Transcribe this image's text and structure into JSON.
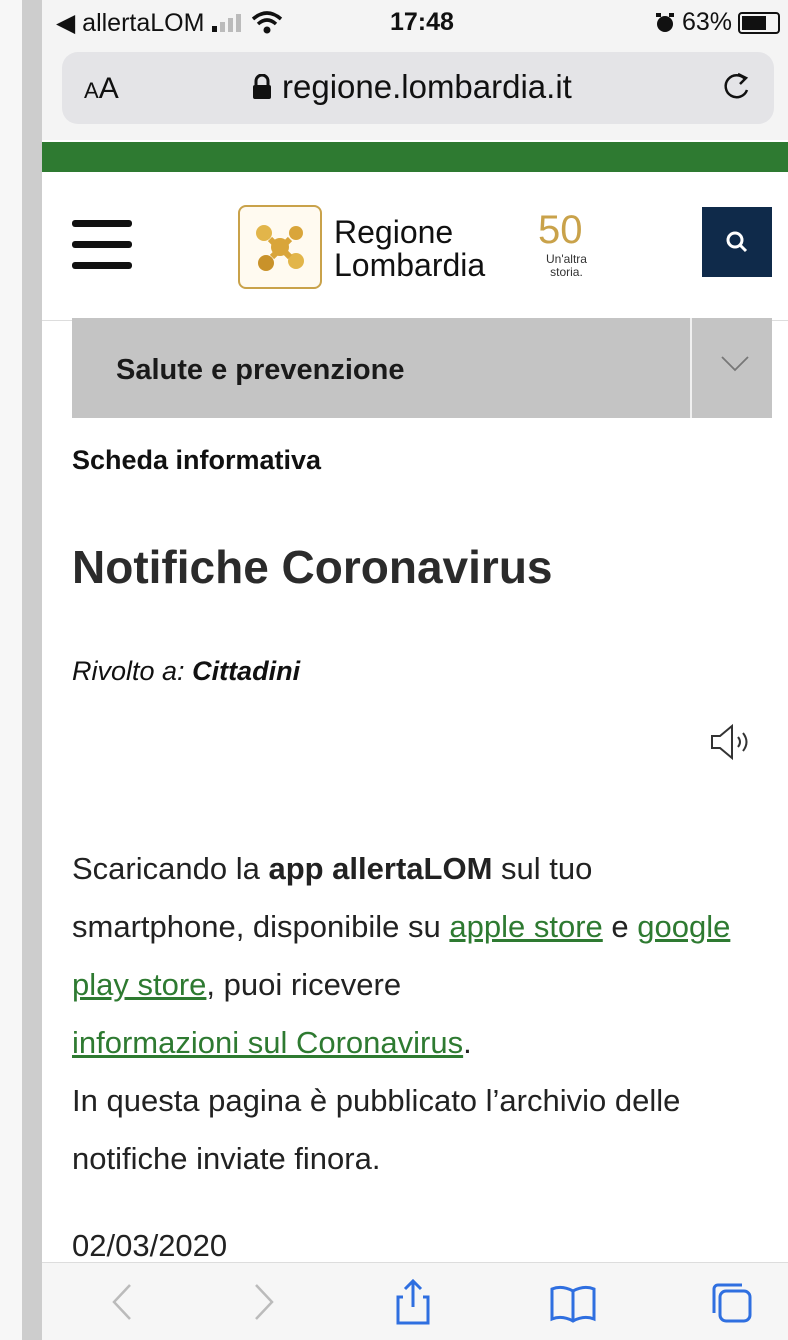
{
  "status_bar": {
    "carrier": "◀ allertaLOM",
    "time": "17:48",
    "battery": "63%",
    "battery_level": 0.63
  },
  "browser": {
    "aa_label_small": "A",
    "aa_label_large": "A",
    "url": "regione.lombardia.it"
  },
  "header": {
    "logo_line1": "Regione",
    "logo_line2": "Lombardia",
    "anniversary_number": "50",
    "anniversary_line1": "Un'altra",
    "anniversary_line2": "storia."
  },
  "section": {
    "title": "Salute e prevenzione"
  },
  "page": {
    "category": "Scheda informativa",
    "title": "Notifiche Coronavirus",
    "audience_label": "Rivolto a:",
    "audience_value": "Cittadini",
    "body": {
      "p1_a": "Scaricando la ",
      "p1_bold": "app allertaLOM",
      "p1_b": " sul tuo smartphone, disponibile su ",
      "link_apple": "apple store",
      "p1_c": " e ",
      "link_google": "google play store",
      "p1_d": ", puoi ricevere ",
      "link_info": "informazioni sul Coronavirus",
      "p1_e": ".",
      "p2": "In questa pagina è pubblicato l’archivio delle notifiche inviate finora."
    },
    "date": "02/03/2020"
  },
  "colors": {
    "green": "#2e7a31",
    "navy": "#0f2a4a",
    "gold": "#c9a24a",
    "section_gray": "#c4c4c4"
  }
}
